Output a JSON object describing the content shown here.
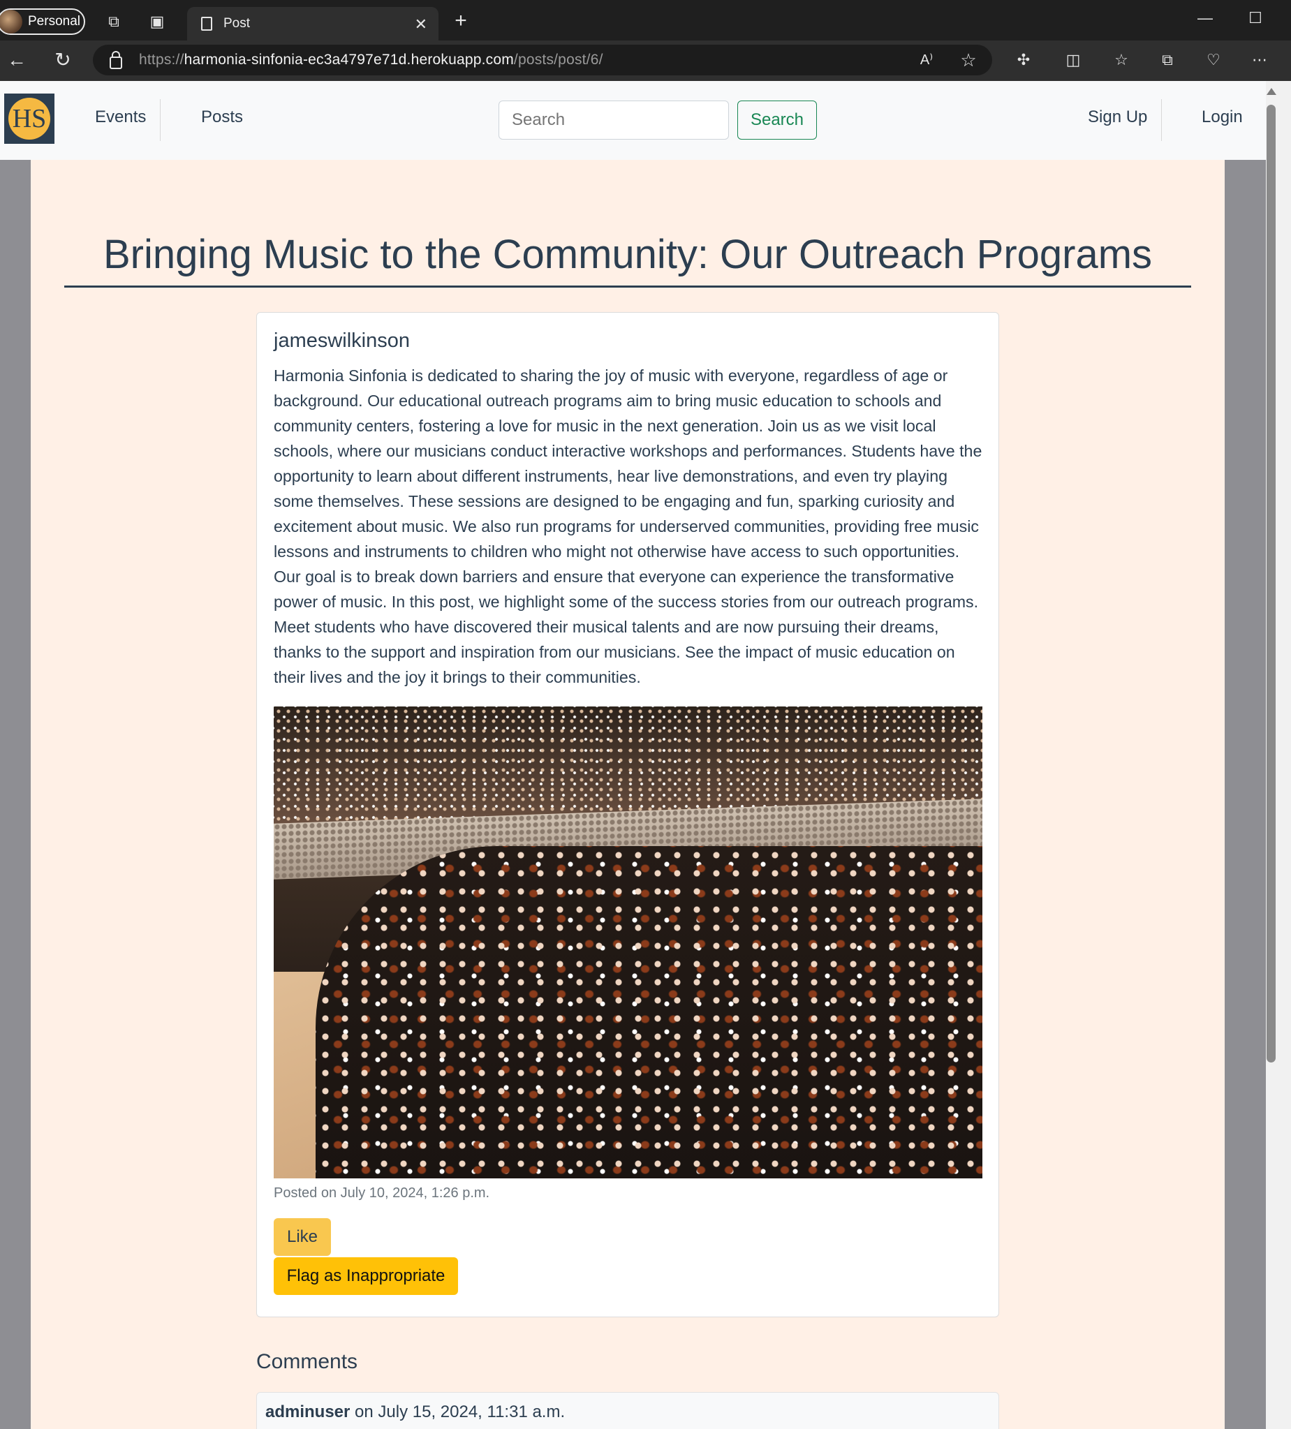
{
  "browser": {
    "profile_label": "Personal",
    "tab_title": "Post",
    "url_scheme": "https://",
    "url_host": "harmonia-sinfonia-ec3a4797e71d.herokuapp.com",
    "url_path": "/posts/post/6/"
  },
  "navbar": {
    "logo_text": "HS",
    "links": [
      "Events",
      "Posts"
    ],
    "search_placeholder": "Search",
    "search_button": "Search",
    "auth_links": [
      "Sign Up",
      "Login"
    ]
  },
  "post": {
    "title": "Bringing Music to the Community: Our Outreach Programs",
    "author": "jameswilkinson",
    "body": "Harmonia Sinfonia is dedicated to sharing the joy of music with everyone, regardless of age or background. Our educational outreach programs aim to bring music education to schools and community centers, fostering a love for music in the next generation. Join us as we visit local schools, where our musicians conduct interactive workshops and performances. Students have the opportunity to learn about different instruments, hear live demonstrations, and even try playing some themselves. These sessions are designed to be engaging and fun, sparking curiosity and excitement about music. We also run programs for underserved communities, providing free music lessons and instruments to children who might not otherwise have access to such opportunities. Our goal is to break down barriers and ensure that everyone can experience the transformative power of music. In this post, we highlight some of the success stories from our outreach programs. Meet students who have discovered their musical talents and are now pursuing their dreams, thanks to the support and inspiration from our musicians. See the impact of music education on their lives and the joy it brings to their communities.",
    "posted_on": "Posted on July 10, 2024, 1:26 p.m.",
    "like_button": "Like",
    "flag_button": "Flag as Inappropriate"
  },
  "comments": {
    "heading": "Comments",
    "items": [
      {
        "author": "adminuser",
        "date_text": "on July 15, 2024, 11:31 a.m."
      }
    ]
  },
  "colors": {
    "primary_text": "#2c3e50",
    "page_background": "#fff0e6",
    "search_green": "#198754",
    "like_yellow": "#f9c74f",
    "flag_yellow": "#ffc107"
  }
}
